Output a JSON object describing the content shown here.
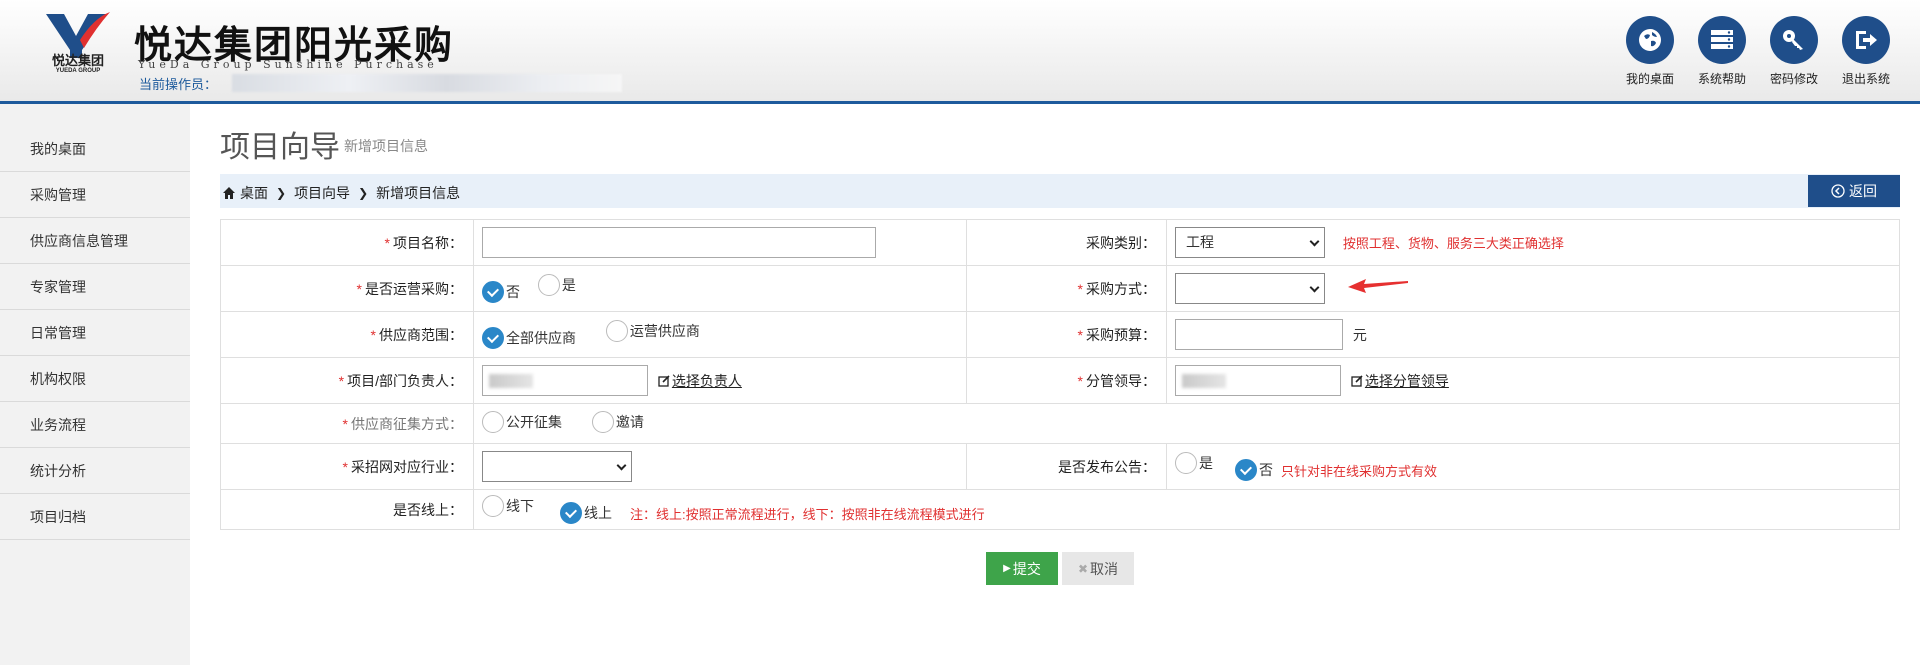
{
  "header": {
    "brand_title": "悦达集团阳光采购",
    "brand_subtitle": "YueDa Group Sunshine Purchase",
    "logo_text": "悦达集团",
    "logo_subtext": "YUEDA GROUP",
    "operator_label": "当前操作员：",
    "actions": [
      {
        "label": "我的桌面",
        "icon": "globe-icon"
      },
      {
        "label": "系统帮助",
        "icon": "server-icon"
      },
      {
        "label": "密码修改",
        "icon": "key-icon"
      },
      {
        "label": "退出系统",
        "icon": "logout-icon"
      }
    ]
  },
  "sidebar": {
    "items": [
      {
        "label": "我的桌面"
      },
      {
        "label": "采购管理"
      },
      {
        "label": "供应商信息管理"
      },
      {
        "label": "专家管理"
      },
      {
        "label": "日常管理"
      },
      {
        "label": "机构权限"
      },
      {
        "label": "业务流程"
      },
      {
        "label": "统计分析"
      },
      {
        "label": "项目归档"
      }
    ]
  },
  "page": {
    "title": "项目向导",
    "subtitle": "新增项目信息",
    "breadcrumb": [
      "桌面",
      "项目向导",
      "新增项目信息"
    ],
    "back_label": "返回"
  },
  "form": {
    "project_name": {
      "label": "项目名称：",
      "value": ""
    },
    "purchase_category": {
      "label": "采购类别：",
      "value": "工程",
      "hint": "按照工程、货物、服务三大类正确选择"
    },
    "operational": {
      "label": "是否运营采购：",
      "options": [
        "否",
        "是"
      ],
      "selected": "否"
    },
    "purchase_method": {
      "label": "采购方式：",
      "value": ""
    },
    "supplier_scope": {
      "label": "供应商范围：",
      "options": [
        "全部供应商",
        "运营供应商"
      ],
      "selected": "全部供应商"
    },
    "budget": {
      "label": "采购预算：",
      "value": "",
      "unit": "元"
    },
    "owner": {
      "label": "项目/部门负责人：",
      "link": "选择负责人"
    },
    "leader": {
      "label": "分管领导：",
      "link": "选择分管领导"
    },
    "solicitation": {
      "label": "供应商征集方式：",
      "options": [
        "公开征集",
        "邀请"
      ],
      "selected": ""
    },
    "industry": {
      "label": "采招网对应行业：",
      "value": ""
    },
    "announce": {
      "label": "是否发布公告：",
      "options": [
        "是",
        "否"
      ],
      "selected": "否",
      "hint": "只针对非在线采购方式有效"
    },
    "online": {
      "label": "是否线上：",
      "options": [
        "线下",
        "线上"
      ],
      "selected": "线上",
      "hint": "注：线上:按照正常流程进行，线下：按照非在线流程模式进行"
    }
  },
  "buttons": {
    "submit": "提交",
    "cancel": "取消"
  },
  "colors": {
    "primary": "#1f4e8a",
    "accent": "#2a87c8",
    "submit": "#3ea44a",
    "required": "#e03030"
  }
}
